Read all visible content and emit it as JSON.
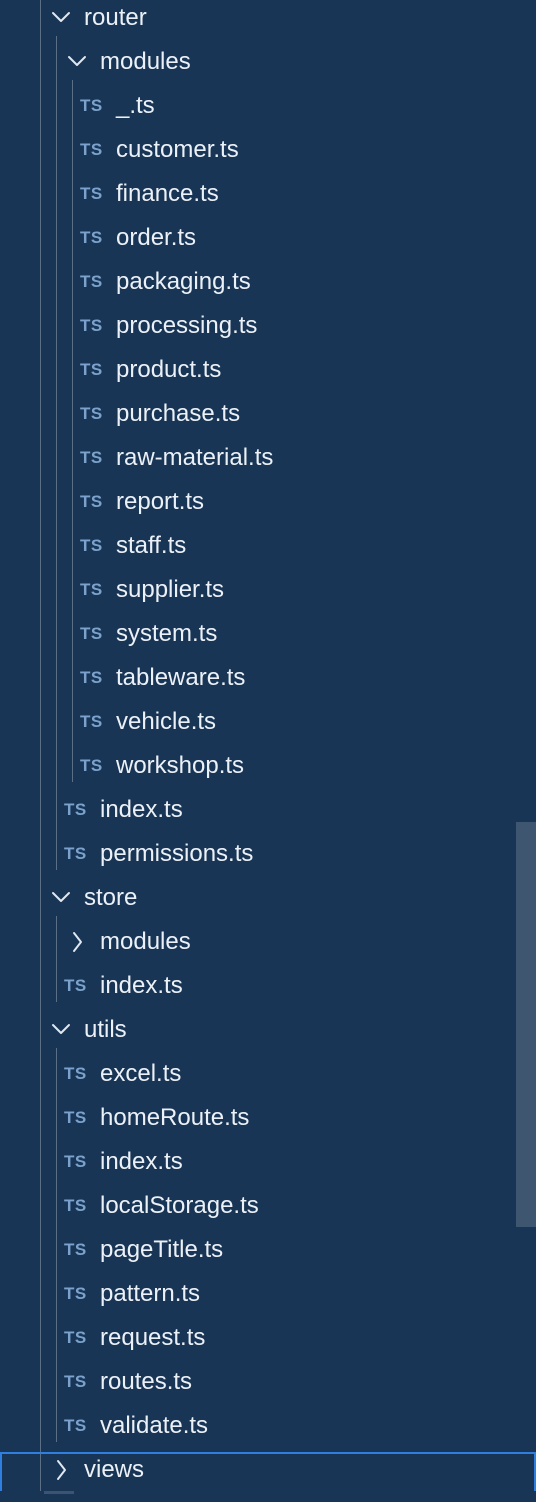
{
  "explorer": {
    "items": [
      {
        "kind": "folder",
        "depth": 0,
        "expanded": true,
        "label": "router",
        "icon": "chevron-down-icon"
      },
      {
        "kind": "folder",
        "depth": 1,
        "expanded": true,
        "label": "modules",
        "icon": "chevron-down-icon"
      },
      {
        "kind": "file",
        "depth": 2,
        "badge": "TS",
        "label": "_.ts"
      },
      {
        "kind": "file",
        "depth": 2,
        "badge": "TS",
        "label": "customer.ts"
      },
      {
        "kind": "file",
        "depth": 2,
        "badge": "TS",
        "label": "finance.ts"
      },
      {
        "kind": "file",
        "depth": 2,
        "badge": "TS",
        "label": "order.ts"
      },
      {
        "kind": "file",
        "depth": 2,
        "badge": "TS",
        "label": "packaging.ts"
      },
      {
        "kind": "file",
        "depth": 2,
        "badge": "TS",
        "label": "processing.ts"
      },
      {
        "kind": "file",
        "depth": 2,
        "badge": "TS",
        "label": "product.ts"
      },
      {
        "kind": "file",
        "depth": 2,
        "badge": "TS",
        "label": "purchase.ts"
      },
      {
        "kind": "file",
        "depth": 2,
        "badge": "TS",
        "label": "raw-material.ts"
      },
      {
        "kind": "file",
        "depth": 2,
        "badge": "TS",
        "label": "report.ts"
      },
      {
        "kind": "file",
        "depth": 2,
        "badge": "TS",
        "label": "staff.ts"
      },
      {
        "kind": "file",
        "depth": 2,
        "badge": "TS",
        "label": "supplier.ts"
      },
      {
        "kind": "file",
        "depth": 2,
        "badge": "TS",
        "label": "system.ts"
      },
      {
        "kind": "file",
        "depth": 2,
        "badge": "TS",
        "label": "tableware.ts"
      },
      {
        "kind": "file",
        "depth": 2,
        "badge": "TS",
        "label": "vehicle.ts"
      },
      {
        "kind": "file",
        "depth": 2,
        "badge": "TS",
        "label": "workshop.ts"
      },
      {
        "kind": "file",
        "depth": 1,
        "badge": "TS",
        "label": "index.ts"
      },
      {
        "kind": "file",
        "depth": 1,
        "badge": "TS",
        "label": "permissions.ts"
      },
      {
        "kind": "folder",
        "depth": 0,
        "expanded": true,
        "label": "store",
        "icon": "chevron-down-icon"
      },
      {
        "kind": "folder",
        "depth": 1,
        "expanded": false,
        "label": "modules",
        "icon": "chevron-right-icon"
      },
      {
        "kind": "file",
        "depth": 1,
        "badge": "TS",
        "label": "index.ts"
      },
      {
        "kind": "folder",
        "depth": 0,
        "expanded": true,
        "label": "utils",
        "icon": "chevron-down-icon"
      },
      {
        "kind": "file",
        "depth": 1,
        "badge": "TS",
        "label": "excel.ts"
      },
      {
        "kind": "file",
        "depth": 1,
        "badge": "TS",
        "label": "homeRoute.ts"
      },
      {
        "kind": "file",
        "depth": 1,
        "badge": "TS",
        "label": "index.ts"
      },
      {
        "kind": "file",
        "depth": 1,
        "badge": "TS",
        "label": "localStorage.ts"
      },
      {
        "kind": "file",
        "depth": 1,
        "badge": "TS",
        "label": "pageTitle.ts"
      },
      {
        "kind": "file",
        "depth": 1,
        "badge": "TS",
        "label": "pattern.ts"
      },
      {
        "kind": "file",
        "depth": 1,
        "badge": "TS",
        "label": "request.ts"
      },
      {
        "kind": "file",
        "depth": 1,
        "badge": "TS",
        "label": "routes.ts"
      },
      {
        "kind": "file",
        "depth": 1,
        "badge": "TS",
        "label": "validate.ts"
      },
      {
        "kind": "folder",
        "depth": 0,
        "expanded": false,
        "selected": true,
        "label": "views",
        "icon": "chevron-right-icon"
      }
    ]
  },
  "colors": {
    "background": "#193555",
    "ts_badge": "#7aa2cc",
    "selection_border": "#2f7fe0",
    "indent_guide": "#5b6f86",
    "scrollbar": "#3f5670"
  }
}
